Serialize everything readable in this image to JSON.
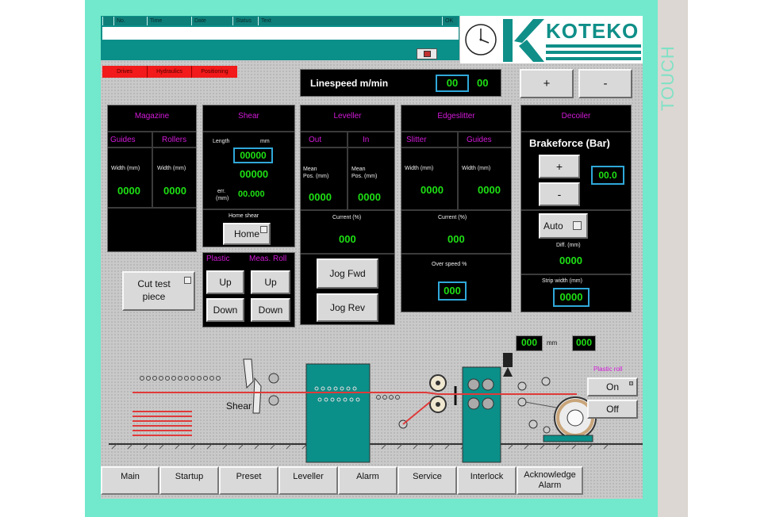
{
  "side_label": "TOUCH",
  "logo": {
    "brand": "KOTEKO"
  },
  "alarm_header": {
    "columns": [
      "No.",
      "Time",
      "Date",
      "Status",
      "Text"
    ],
    "ok_label": "OK"
  },
  "status_tabs": [
    "Drives",
    "Hydraulics",
    "Positioning"
  ],
  "linespeed": {
    "label": "Linespeed m/min",
    "setpoint": "00",
    "actual": "00"
  },
  "speed_buttons": {
    "plus": "+",
    "minus": "-"
  },
  "magazine": {
    "title": "Magazine",
    "col1": "Guides",
    "col2": "Rollers",
    "width1_label": "Width (mm)",
    "width2_label": "Width (mm)",
    "width1": "0000",
    "width2": "0000"
  },
  "shear": {
    "title": "Shear",
    "length_label": "Length",
    "unit_mm": "mm",
    "length_set": "00000",
    "length_act": "00000",
    "err_label": "err.",
    "err_unit": "(mm)",
    "err_value": "00.000",
    "home_label": "Home shear",
    "home_button": "Home"
  },
  "leveller": {
    "title": "Leveller",
    "col1": "Out",
    "col2": "In",
    "pos1_label1": "Mean",
    "pos1_label2": "Pos. (mm)",
    "pos2_label1": "Mean",
    "pos2_label2": "Pos. (mm)",
    "pos1": "0000",
    "pos2": "0000",
    "current_label": "Current (%)",
    "current": "000"
  },
  "edgeslitter": {
    "title": "Edgeslitter",
    "col1": "Slitter",
    "col2": "Guides",
    "width1_label": "Width (mm)",
    "width2_label": "Width (mm)",
    "width1": "0000",
    "width2": "0000",
    "current_label": "Current (%)",
    "current": "000",
    "overspeed_label": "Over speed %",
    "overspeed": "000"
  },
  "decoiler": {
    "title": "Decoiler",
    "brake_label": "Brakeforce (Bar)",
    "plus": "+",
    "minus": "-",
    "brake_value": "00.0",
    "auto_label": "Auto",
    "diff_label": "Diff. (mm)",
    "diff_value": "0000",
    "strip_label": "Strip width (mm)",
    "strip_value": "0000"
  },
  "plastic_group": {
    "plastic_label": "Plastic",
    "meas_label": "Meas. Roll",
    "up": "Up",
    "down": "Down"
  },
  "cut_test": {
    "label": "Cut test piece"
  },
  "jog": {
    "fwd": "Jog Fwd",
    "rev": "Jog Rev"
  },
  "diagram": {
    "shear_label": "Shear",
    "sensor_value": "000",
    "sensor_unit": "mm",
    "sensor_value2": "000",
    "plastic_roll_label": "Plastic roll",
    "on": "On",
    "off": "Off"
  },
  "nav": [
    "Main",
    "Startup",
    "Preset",
    "Leveller",
    "Alarm",
    "Service",
    "Interlock",
    "Acknowledge Alarm"
  ],
  "colors": {
    "bezel": "#72e8cc",
    "panel": "#000000",
    "value_green": "#1ee014",
    "title_magenta": "#d21ad8",
    "machine_teal": "#0b8f89",
    "strip_red": "#e53a3a"
  }
}
